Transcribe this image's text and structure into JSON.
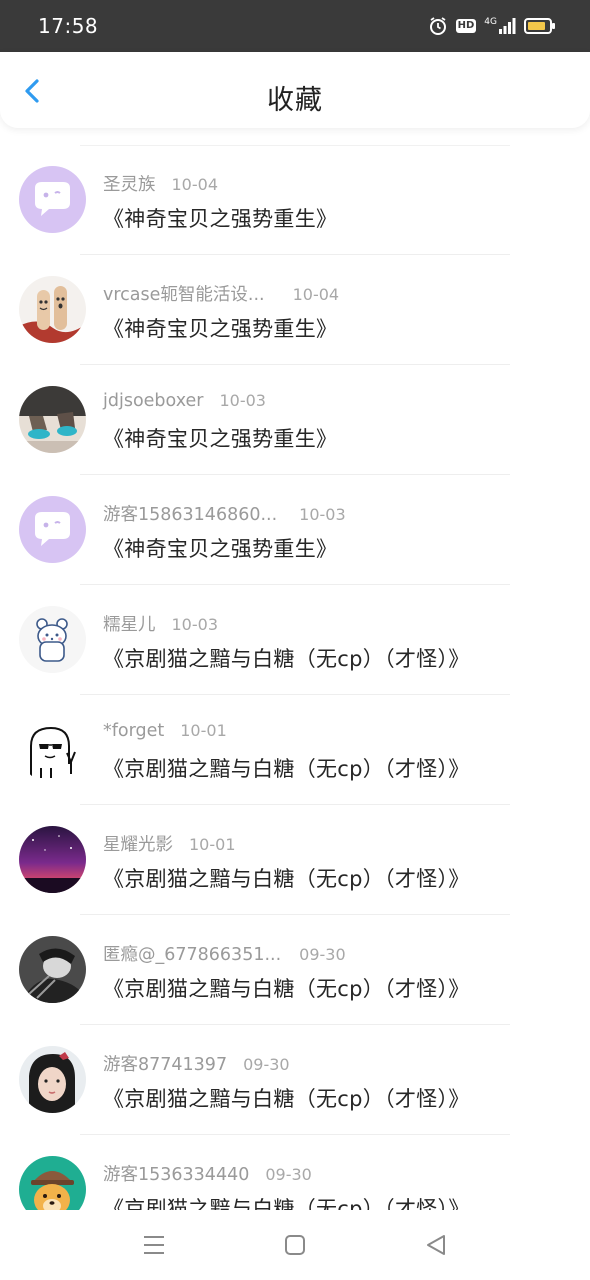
{
  "status_bar": {
    "time": "17:58",
    "hd_label": "HD",
    "network_label": "4G",
    "icons": [
      "alarm-icon",
      "hd-icon",
      "signal-icon",
      "battery-icon"
    ]
  },
  "header": {
    "title": "收藏",
    "back_icon": "chevron-left-icon",
    "accent_color": "#2f9bf0"
  },
  "items": [
    {
      "username": "圣灵族",
      "date": "10-04",
      "title": "《神奇宝贝之强势重生》",
      "avatar": "purple-chat-bubble"
    },
    {
      "username": "vrcase轭智能活设...",
      "date": "10-04",
      "title": "《神奇宝贝之强势重生》",
      "avatar": "finger-faces"
    },
    {
      "username": "jdjsoeboxer",
      "date": "10-03",
      "title": "《神奇宝贝之强势重生》",
      "avatar": "sneakers-photo"
    },
    {
      "username": "游客15863146860...",
      "date": "10-03",
      "title": "《神奇宝贝之强势重生》",
      "avatar": "purple-chat-bubble"
    },
    {
      "username": "糯星儿",
      "date": "10-03",
      "title": "《京剧猫之黯与白糖（无cp）（才怪）》",
      "avatar": "cartoon-bear"
    },
    {
      "username": "*forget",
      "date": "10-01",
      "title": "《京剧猫之黯与白糖（无cp）（才怪）》",
      "avatar": "sunglasses-doodle"
    },
    {
      "username": "星耀光影",
      "date": "10-01",
      "title": "《京剧猫之黯与白糖（无cp）（才怪）》",
      "avatar": "galaxy-sky"
    },
    {
      "username": "匿瘾@_677866351...",
      "date": "09-30",
      "title": "《京剧猫之黯与白糖（无cp）（才怪）》",
      "avatar": "bw-portrait"
    },
    {
      "username": "游客87741397",
      "date": "09-30",
      "title": "《京剧猫之黯与白糖（无cp）（才怪）》",
      "avatar": "girl-portrait"
    },
    {
      "username": "游客1536334440",
      "date": "09-30",
      "title": "《京剧猫之黯与白糖（无cp）（才怪）》",
      "avatar": "dog-helmet"
    }
  ],
  "nav_bar": {
    "icons": [
      "menu-icon",
      "home-square-icon",
      "back-triangle-icon"
    ]
  }
}
